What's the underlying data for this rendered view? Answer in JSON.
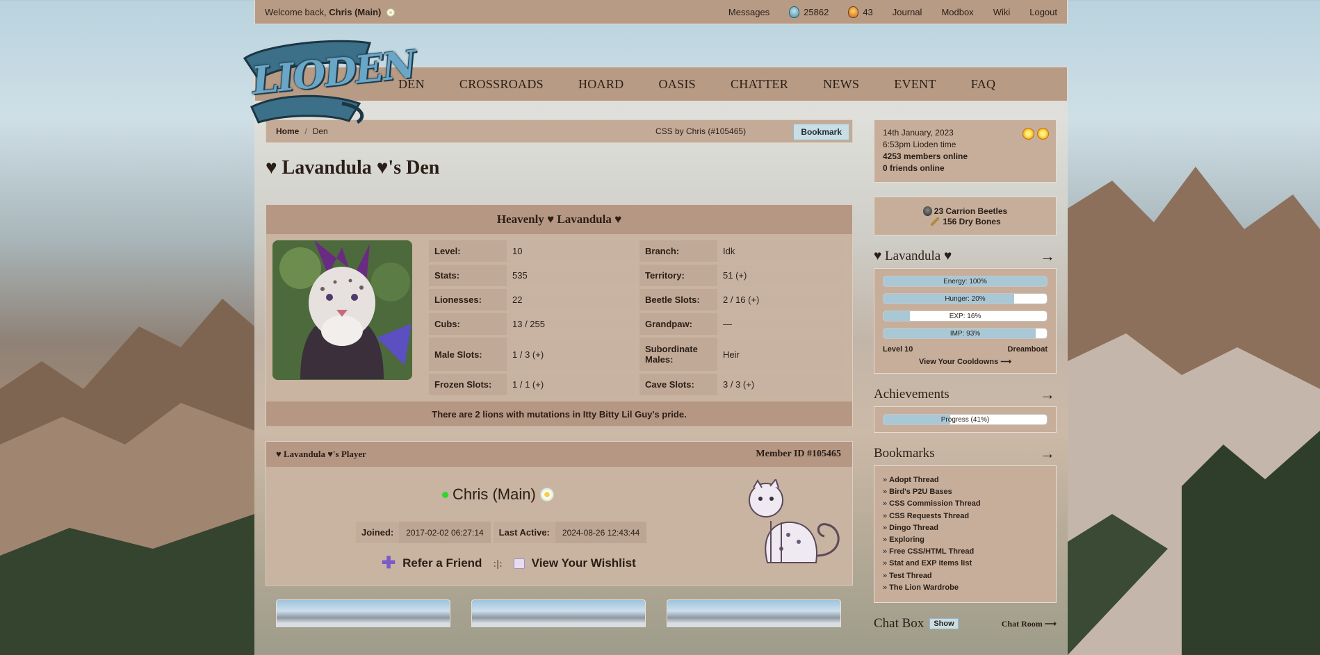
{
  "topbar": {
    "welcome_prefix": "Welcome back,",
    "username": "Chris (Main)",
    "messages": "Messages",
    "blue_beetles": "25862",
    "orange_beetles": "43",
    "journal": "Journal",
    "modbox": "Modbox",
    "wiki": "Wiki",
    "logout": "Logout"
  },
  "logo": {
    "text": "LIODEN"
  },
  "nav": [
    "DEN",
    "CROSSROADS",
    "HOARD",
    "OASIS",
    "CHATTER",
    "NEWS",
    "EVENT",
    "FAQ"
  ],
  "breadcrumb": {
    "home": "Home",
    "separator": "/",
    "current": "Den",
    "css_by": "CSS by Chris (#105465)",
    "bookmark": "Bookmark"
  },
  "den_title": "♥ Lavandula ♥'s Den",
  "lion": {
    "name": "Heavenly ♥ Lavandula ♥",
    "stats_left": [
      {
        "k": "Level:",
        "v": "10"
      },
      {
        "k": "Stats:",
        "v": "535"
      },
      {
        "k": "Lionesses:",
        "v": "22"
      },
      {
        "k": "Cubs:",
        "v": "13 / 255"
      },
      {
        "k": "Male Slots:",
        "v": "1 / 3 (+)"
      },
      {
        "k": "Frozen Slots:",
        "v": "1 / 1 (+)"
      }
    ],
    "stats_right": [
      {
        "k": "Branch:",
        "v": "Idk"
      },
      {
        "k": "Territory:",
        "v": "51 (+)"
      },
      {
        "k": "Beetle Slots:",
        "v": "2 / 16 (+)"
      },
      {
        "k": "Grandpaw:",
        "v": "—"
      },
      {
        "k": "Subordinate Males:",
        "v": "Heir"
      },
      {
        "k": "Cave Slots:",
        "v": "3 / 3 (+)"
      }
    ],
    "mutation_text": "There are 2 lions with mutations in Itty Bitty Lil Guy's pride."
  },
  "player": {
    "header_left": "♥ Lavandula ♥'s Player",
    "member_id_label": "Member ID",
    "member_id": "#105465",
    "name": "Chris (Main)",
    "joined_label": "Joined:",
    "joined": "2017-02-02 06:27:14",
    "last_active_label": "Last Active:",
    "last_active": "2024-08-26 12:43:44",
    "refer": "Refer a Friend",
    "divider": ":|:",
    "wishlist": "View Your Wishlist"
  },
  "sidebar": {
    "date": "14th January, 2023",
    "time": "6:53pm Lioden time",
    "members_online": "4253 members online",
    "friends_online": "0 friends online",
    "carrion_beetles": "23 Carrion Beetles",
    "dry_bones": "156 Dry Bones",
    "lion_title": "♥ Lavandula ♥",
    "arrow": "→",
    "bars": [
      {
        "label": "Energy: 100%",
        "pct": 100
      },
      {
        "label": "Hunger: 20%",
        "pct": 80
      },
      {
        "label": "EXP: 16%",
        "pct": 16
      },
      {
        "label": "IMP: 93%",
        "pct": 93
      }
    ],
    "level": "Level 10",
    "rank": "Dreamboat",
    "cooldowns": "View Your Cooldowns ⟶",
    "achievements_title": "Achievements",
    "progress": {
      "label": "Progress (41%)",
      "pct": 41
    },
    "bookmarks_title": "Bookmarks",
    "bookmarks": [
      "Adopt Thread",
      "Bird's P2U Bases",
      "CSS Commission Thread",
      "CSS Requests Thread",
      "Dingo Thread",
      "Exploring",
      "Free CSS/HTML Thread",
      "Stat and EXP items list",
      "Test Thread",
      "The Lion Wardrobe"
    ],
    "bullet": "»",
    "chatbox_title": "Chat Box",
    "show": "Show",
    "chat_room": "Chat Room ⟶"
  },
  "colors": {
    "panel": "#b79b85",
    "header": "#b59783",
    "accent_bar": "#a9c8d6",
    "online": "#2fd62f"
  }
}
